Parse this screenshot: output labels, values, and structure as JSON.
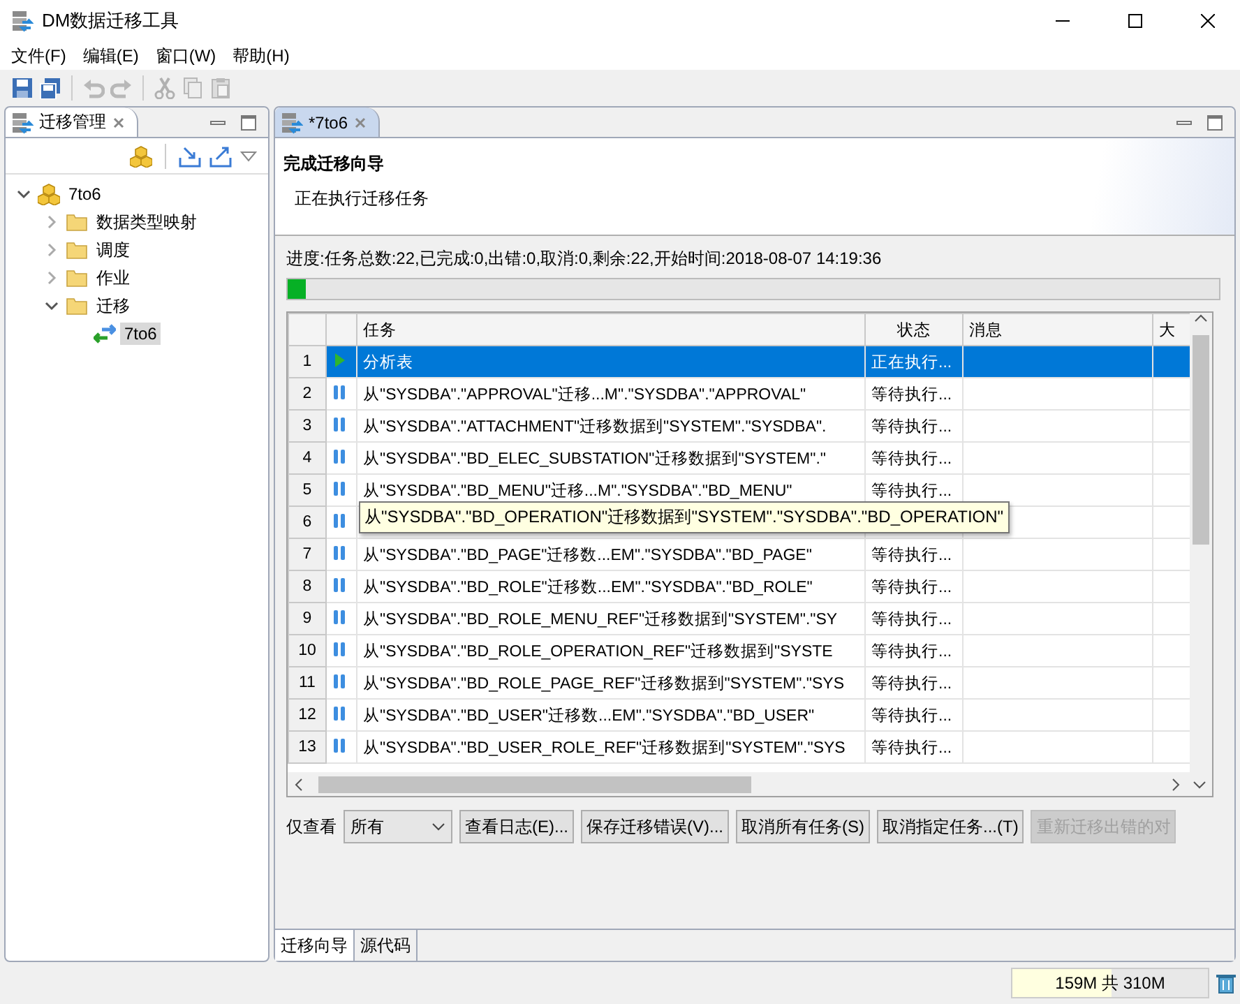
{
  "window": {
    "title": "DM数据迁移工具"
  },
  "menu": [
    {
      "label": "文件(F)"
    },
    {
      "label": "编辑(E)"
    },
    {
      "label": "窗口(W)"
    },
    {
      "label": "帮助(H)"
    }
  ],
  "left_panel": {
    "tab": {
      "label": "迁移管理"
    },
    "tree": [
      {
        "label": "7to6",
        "kind": "project",
        "expanded": true,
        "selected": false,
        "children": [
          {
            "label": "数据类型映射",
            "kind": "folder",
            "expanded": false,
            "selected": false
          },
          {
            "label": "调度",
            "kind": "folder",
            "expanded": false,
            "selected": false
          },
          {
            "label": "作业",
            "kind": "folder",
            "expanded": false,
            "selected": false
          },
          {
            "label": "迁移",
            "kind": "folder",
            "expanded": true,
            "selected": false,
            "children": [
              {
                "label": "7to6",
                "kind": "migration",
                "selected": true
              }
            ]
          }
        ]
      }
    ]
  },
  "editor": {
    "tab": {
      "label": "*7to6"
    },
    "wizard": {
      "title": "完成迁移向导",
      "subtitle": "正在执行迁移任务"
    },
    "progress": {
      "text": "进度:任务总数:22,已完成:0,出错:0,取消:0,剩余:22,开始时间:2018-08-07 14:19:36",
      "level": 0.02
    },
    "table": {
      "columns": [
        "任务",
        "状态",
        "消息",
        "大"
      ],
      "rows": [
        {
          "number": "1",
          "kind": "running",
          "task": "分析表",
          "status": "正在执行...",
          "selected": true
        },
        {
          "number": "2",
          "kind": "waiting",
          "task": "从\"SYSDBA\".\"APPROVAL\"迁移...M\".\"SYSDBA\".\"APPROVAL\"",
          "status": "等待执行...",
          "selected": false
        },
        {
          "number": "3",
          "kind": "waiting",
          "task": "从\"SYSDBA\".\"ATTACHMENT\"迁移数据到\"SYSTEM\".\"SYSDBA\".",
          "status": "等待执行...",
          "selected": false
        },
        {
          "number": "4",
          "kind": "waiting",
          "task": "从\"SYSDBA\".\"BD_ELEC_SUBSTATION\"迁移数据到\"SYSTEM\".\"",
          "status": "等待执行...",
          "selected": false
        },
        {
          "number": "5",
          "kind": "waiting",
          "task": "从\"SYSDBA\".\"BD_MENU\"迁移...M\".\"SYSDBA\".\"BD_MENU\"",
          "status": "等待执行...",
          "selected": false
        },
        {
          "number": "6",
          "kind": "waiting",
          "selected": false
        },
        {
          "number": "7",
          "kind": "waiting",
          "task": "从\"SYSDBA\".\"BD_PAGE\"迁移数...EM\".\"SYSDBA\".\"BD_PAGE\"",
          "status": "等待执行...",
          "selected": false
        },
        {
          "number": "8",
          "kind": "waiting",
          "task": "从\"SYSDBA\".\"BD_ROLE\"迁移数...EM\".\"SYSDBA\".\"BD_ROLE\"",
          "status": "等待执行...",
          "selected": false
        },
        {
          "number": "9",
          "kind": "waiting",
          "task": "从\"SYSDBA\".\"BD_ROLE_MENU_REF\"迁移数据到\"SYSTEM\".\"SY",
          "status": "等待执行...",
          "selected": false
        },
        {
          "number": "10",
          "kind": "waiting",
          "task": "从\"SYSDBA\".\"BD_ROLE_OPERATION_REF\"迁移数据到\"SYSTE",
          "status": "等待执行...",
          "selected": false
        },
        {
          "number": "11",
          "kind": "waiting",
          "task": "从\"SYSDBA\".\"BD_ROLE_PAGE_REF\"迁移数据到\"SYSTEM\".\"SYS",
          "status": "等待执行...",
          "selected": false
        },
        {
          "number": "12",
          "kind": "waiting",
          "task": "从\"SYSDBA\".\"BD_USER\"迁移数...EM\".\"SYSDBA\".\"BD_USER\"",
          "status": "等待执行...",
          "selected": false
        },
        {
          "number": "13",
          "kind": "waiting",
          "task": "从\"SYSDBA\".\"BD_USER_ROLE_REF\"迁移数据到\"SYSTEM\".\"SYS",
          "status": "等待执行...",
          "selected": false
        }
      ]
    },
    "tooltip": "从\"SYSDBA\".\"BD_OPERATION\"迁移数据到\"SYSTEM\".\"SYSDBA\".\"BD_OPERATION\"",
    "filter": {
      "label": "仅查看",
      "value": "所有"
    },
    "buttons": [
      {
        "label": "查看日志(E)...",
        "disabled": false
      },
      {
        "label": "保存迁移错误(V)...",
        "disabled": false
      },
      {
        "label": "取消所有任务(S)",
        "disabled": false
      },
      {
        "label": "取消指定任务...(T)",
        "disabled": false
      },
      {
        "label": "重新迁移出错的对",
        "disabled": true
      }
    ],
    "bottom_tabs": [
      {
        "label": "迁移向导",
        "selected": true
      },
      {
        "label": "源代码",
        "selected": false
      }
    ]
  },
  "status_bar": {
    "memory": "159M 共 310M",
    "level": 0.51
  }
}
